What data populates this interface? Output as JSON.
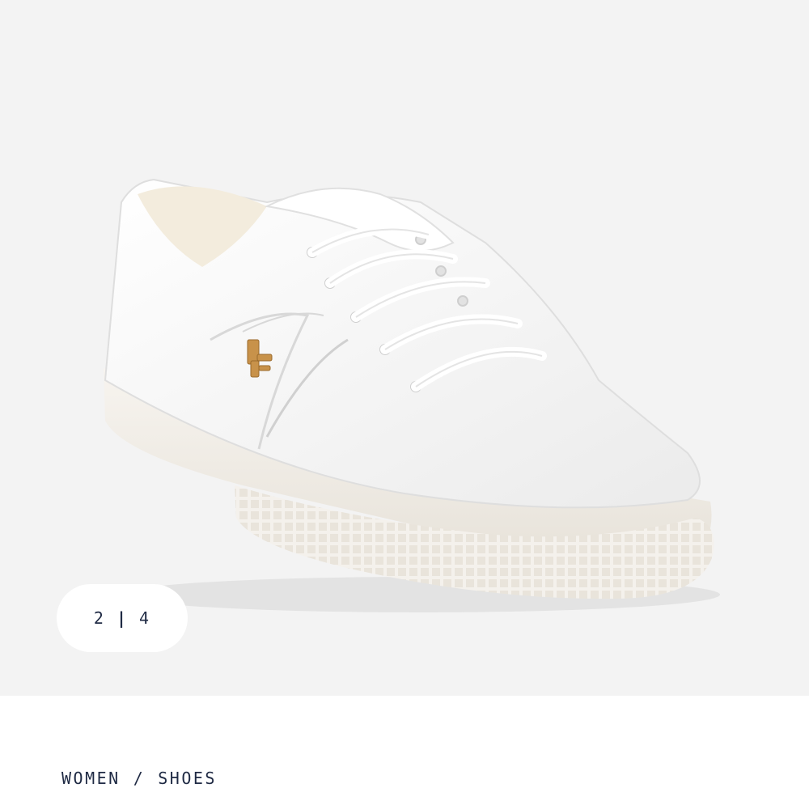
{
  "gallery": {
    "image_alt": "white leather low-top sneaker with gold RL logo",
    "counter": {
      "current": "2",
      "separator": "|",
      "total": "4"
    }
  },
  "breadcrumb": {
    "items": [
      "WOMEN",
      "SHOES"
    ],
    "separator": "/"
  },
  "colors": {
    "gallery_background": "#f3f3f3",
    "text_navy": "#1f2a44",
    "logo_gold": "#c8924a"
  }
}
